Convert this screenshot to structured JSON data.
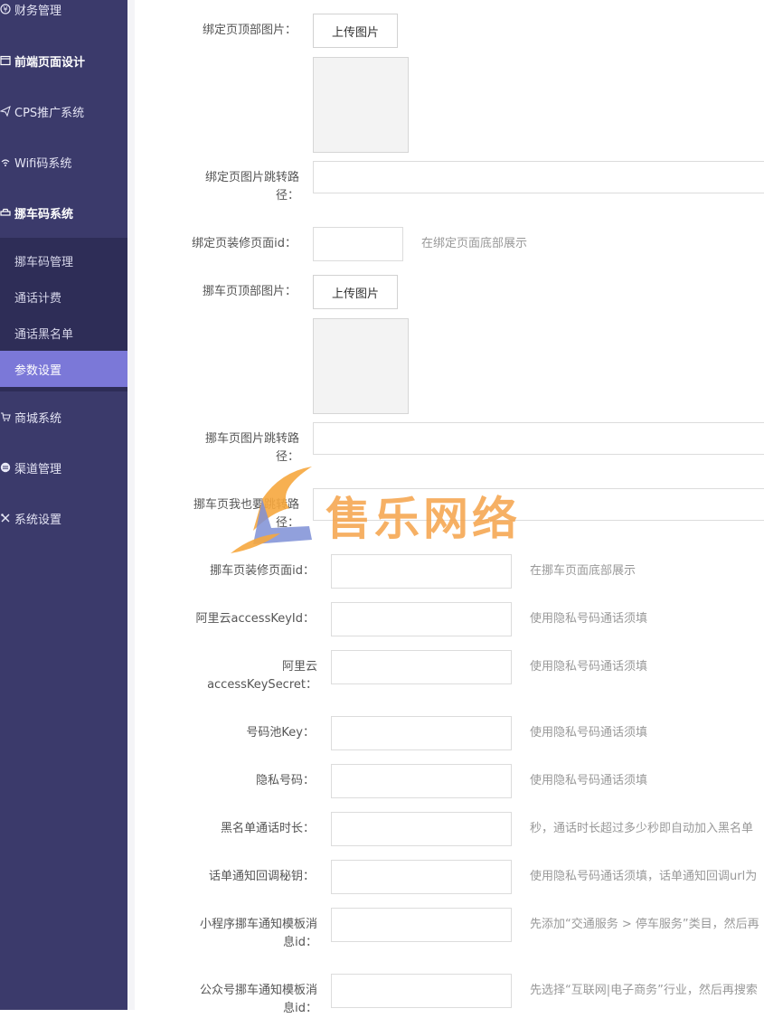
{
  "sidebar": {
    "items": [
      {
        "label": "财务管理",
        "icon": "money-circle-icon"
      },
      {
        "label": "前端页面设计",
        "icon": "layout-window-icon"
      },
      {
        "label": "CPS推广系统",
        "icon": "paper-plane-icon"
      },
      {
        "label": "Wifi码系统",
        "icon": "wifi-icon"
      },
      {
        "label": "挪车码系统",
        "icon": "car-icon"
      },
      {
        "label": "商城系统",
        "icon": "cart-icon"
      },
      {
        "label": "渠道管理",
        "icon": "channel-circle-icon"
      },
      {
        "label": "系统设置",
        "icon": "tools-icon"
      }
    ],
    "submenu": [
      {
        "label": "挪车码管理"
      },
      {
        "label": "通话计费"
      },
      {
        "label": "通话黑名单"
      },
      {
        "label": "参数设置"
      }
    ]
  },
  "form": {
    "upload_label": "上传图片",
    "fields": {
      "bind_top_image": "绑定页顶部图片：",
      "bind_image_path_l1": "绑定页图片跳转路",
      "bind_image_path_l2": "径：",
      "bind_decor_id": "绑定页装修页面id：",
      "bind_decor_hint": "在绑定页面底部展示",
      "move_top_image": "挪车页顶部图片：",
      "move_image_path_l1": "挪车页图片跳转路",
      "move_image_path_l2": "径：",
      "move_also_path_l1": "挪车页我也要跳转路",
      "move_also_path_l2": "径：",
      "move_decor_id": "挪车页装修页面id：",
      "move_decor_hint": "在挪车页面底部展示",
      "aliyun_key_id": "阿里云accessKeyId：",
      "aliyun_key_id_hint": "使用隐私号码通话须填",
      "aliyun_secret_l1": "阿里云",
      "aliyun_secret_l2": "accessKeySecret：",
      "aliyun_secret_hint": "使用隐私号码通话须填",
      "pool_key": "号码池Key：",
      "pool_key_hint": "使用隐私号码通话须填",
      "private_number": "隐私号码：",
      "private_number_hint": "使用隐私号码通话须填",
      "blacklist_duration": "黑名单通话时长：",
      "blacklist_duration_hint": "秒，通话时长超过多少秒即自动加入黑名单",
      "callback_secret": "话单通知回调秘钥：",
      "callback_secret_hint": "使用隐私号码通话须填，话单通知回调url为",
      "mini_template_l1": "小程序挪车通知模板消",
      "mini_template_l2": "息id：",
      "mini_template_hint": "先添加“交通服务 > 停车服务”类目，然后再",
      "mp_template_l1": "公众号挪车通知模板消",
      "mp_template_l2": "息id：",
      "mp_template_hint": "先选择“互联网|电子商务”行业，然后再搜索"
    }
  },
  "watermark": {
    "text": "售乐网络",
    "color": "#f5a34a"
  },
  "colors": {
    "sidebar_bg": "#3b3a6b",
    "submenu_bg": "#2e2d57",
    "active_bg": "#7b78d8"
  }
}
